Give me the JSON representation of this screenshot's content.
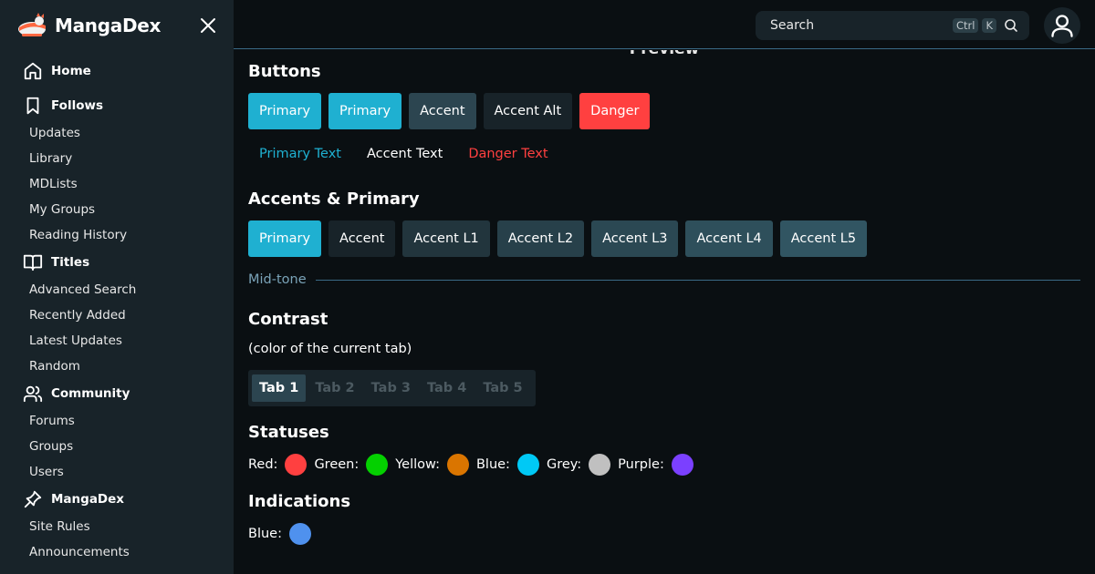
{
  "brand": {
    "name": "MangaDex"
  },
  "sidebar": {
    "sections": [
      {
        "label": "Home",
        "icon": "home-icon",
        "items": []
      },
      {
        "label": "Follows",
        "icon": "bookmark-icon",
        "items": [
          "Updates",
          "Library",
          "MDLists",
          "My Groups",
          "Reading History"
        ]
      },
      {
        "label": "Titles",
        "icon": "book-icon",
        "items": [
          "Advanced Search",
          "Recently Added",
          "Latest Updates",
          "Random"
        ]
      },
      {
        "label": "Community",
        "icon": "users-icon",
        "items": [
          "Forums",
          "Groups",
          "Users"
        ]
      },
      {
        "label": "MangaDex",
        "icon": "pin-icon",
        "items": [
          "Site Rules",
          "Announcements"
        ]
      }
    ]
  },
  "topbar": {
    "search_placeholder": "Search",
    "shortcut_ctrl": "Ctrl",
    "shortcut_key": "K"
  },
  "main": {
    "preview_label": "Preview",
    "buttons_heading": "Buttons",
    "buttons": [
      {
        "label": "Primary",
        "bg": "#1fb0d1",
        "color": "#ffffff"
      },
      {
        "label": "Primary",
        "bg": "#1fb0d1",
        "color": "#ffffff"
      },
      {
        "label": "Accent",
        "bg": "#2c4550",
        "color": "#ffffff"
      },
      {
        "label": "Accent Alt",
        "bg": "#182329",
        "color": "#ffffff"
      },
      {
        "label": "Danger",
        "bg": "#ff4040",
        "color": "#ffffff"
      }
    ],
    "text_buttons": [
      {
        "label": "Primary Text",
        "color": "#1fb0d1"
      },
      {
        "label": "Accent Text",
        "color": "#ffffff"
      },
      {
        "label": "Danger Text",
        "color": "#ff4040"
      }
    ],
    "accents_heading": "Accents & Primary",
    "accents": [
      {
        "label": "Primary",
        "bg": "#1fb0d1"
      },
      {
        "label": "Accent",
        "bg": "#182329"
      },
      {
        "label": "Accent L1",
        "bg": "#22353d"
      },
      {
        "label": "Accent L2",
        "bg": "#27404a"
      },
      {
        "label": "Accent L3",
        "bg": "#2b4853"
      },
      {
        "label": "Accent L4",
        "bg": "#2e4f5b"
      },
      {
        "label": "Accent L5",
        "bg": "#315562"
      }
    ],
    "midtone_label": "Mid-tone",
    "contrast_heading": "Contrast",
    "contrast_note": "(color of the current tab)",
    "tabs": [
      "Tab 1",
      "Tab 2",
      "Tab 3",
      "Tab 4",
      "Tab 5"
    ],
    "active_tab_index": 0,
    "statuses_heading": "Statuses",
    "statuses": [
      {
        "label": "Red:",
        "color": "#ff4040"
      },
      {
        "label": "Green:",
        "color": "#04d000"
      },
      {
        "label": "Yellow:",
        "color": "#da7500"
      },
      {
        "label": "Blue:",
        "color": "#00c9f5"
      },
      {
        "label": "Grey:",
        "color": "#c0c0c0"
      },
      {
        "label": "Purple:",
        "color": "#7b40ff"
      }
    ],
    "indications_heading": "Indications",
    "indications": [
      {
        "label": "Blue:",
        "color": "#4f91ee"
      }
    ]
  }
}
